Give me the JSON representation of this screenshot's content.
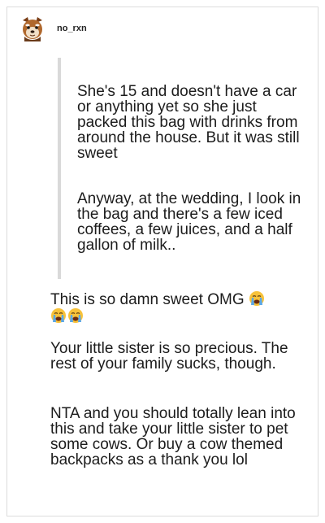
{
  "post": {
    "username": "no_rxn",
    "avatar_icon": "red-panda-avatar-icon"
  },
  "quote": {
    "paragraph1": "She's 15 and doesn't have a car or anything yet so she just packed this bag with drinks from around the house. But it was still sweet",
    "paragraph2": "Anyway, at the wedding, I look in the bag and there's a few iced coffees, a few juices, and a half gallon of milk.."
  },
  "reply": {
    "line1_text": "This is so damn sweet OMG",
    "emoji_name": "loudly-crying-face-icon",
    "paragraph2": "Your little sister is so precious. The rest of your family sucks, though.",
    "paragraph3": "NTA and you should totally lean into this and take your little sister to pet some cows. Or buy a cow themed backpacks as a thank you lol"
  },
  "colors": {
    "quote_bar": "#d9d9d9",
    "card_border": "#dcdcdc",
    "text": "#1c1c1c"
  }
}
